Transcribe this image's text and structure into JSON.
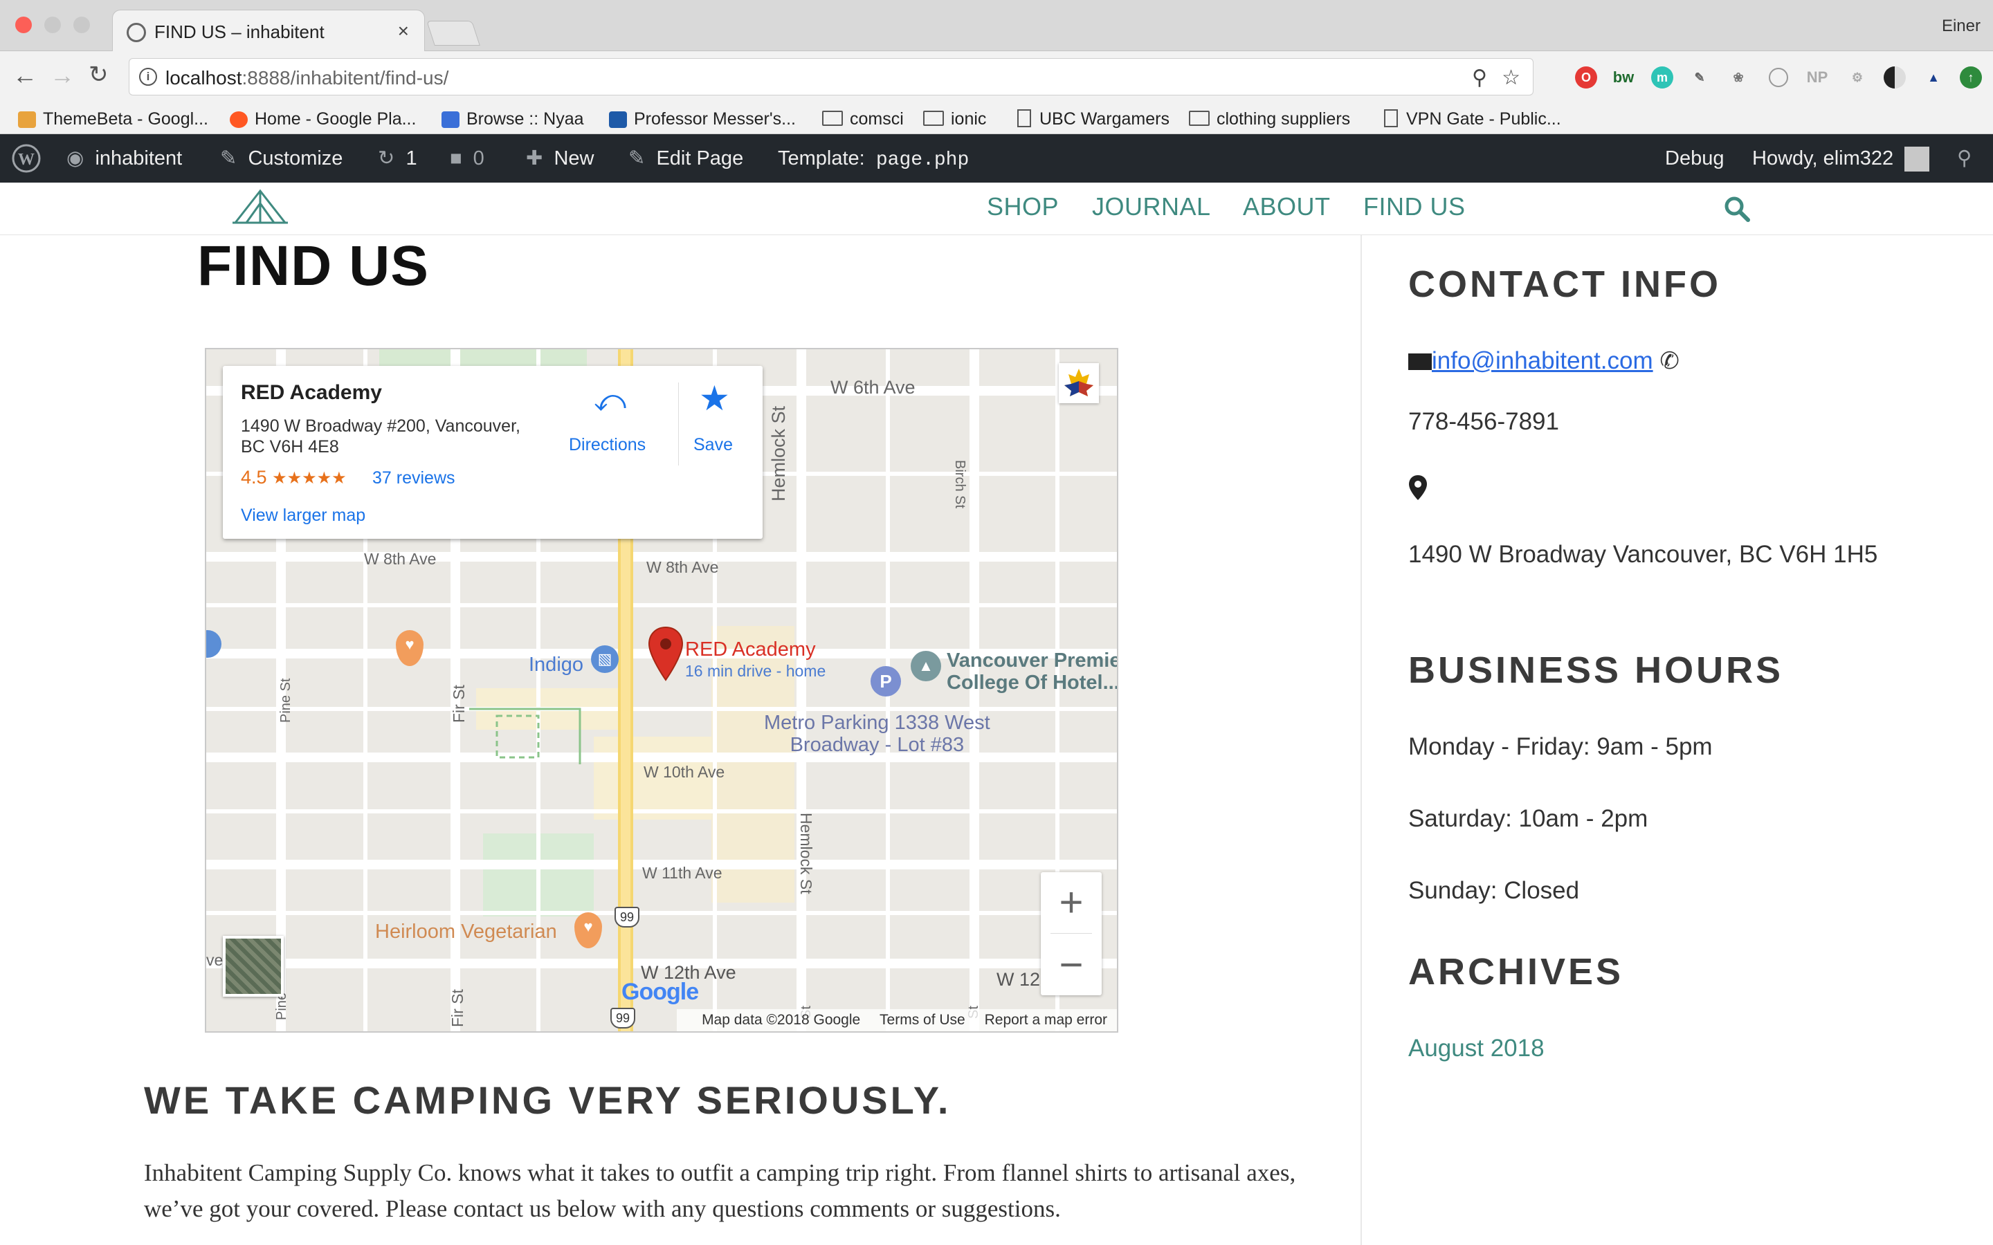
{
  "browser": {
    "tab_title": "FIND US – inhabitent",
    "tab_close": "×",
    "profile_name": "Einer",
    "url_host": "localhost",
    "url_rest": ":8888/inhabitent/find-us/",
    "info_glyph": "i",
    "extensions": [
      "O",
      "bw",
      "m",
      "NP"
    ]
  },
  "bookmarks": [
    {
      "label": "ThemeBeta - Googl...",
      "icon": "themebeta-icon",
      "color": "#e8a33d"
    },
    {
      "label": "Home - Google Pla...",
      "icon": "music-icon",
      "color": "#ff5722"
    },
    {
      "label": "Browse :: Nyaa",
      "icon": "nyaa-icon",
      "color": "#3a6fd8"
    },
    {
      "label": "Professor Messer's...",
      "icon": "professor-icon",
      "color": "#1e5aa8"
    },
    {
      "label": "comsci",
      "icon": "folder-icon"
    },
    {
      "label": "ionic",
      "icon": "folder-icon"
    },
    {
      "label": "UBC Wargamers",
      "icon": "document-icon"
    },
    {
      "label": "clothing suppliers",
      "icon": "folder-icon"
    },
    {
      "label": "VPN Gate - Public...",
      "icon": "document-icon"
    }
  ],
  "adminbar": {
    "site_name": "inhabitent",
    "customize": "Customize",
    "updates_count": "1",
    "comments_count": "0",
    "new_label": "New",
    "edit_label": "Edit Page",
    "template_label": "Template:",
    "template_file": "page.php",
    "debug": "Debug",
    "howdy": "Howdy, elim322"
  },
  "nav": {
    "items": [
      "SHOP",
      "JOURNAL",
      "ABOUT",
      "FIND US"
    ]
  },
  "page": {
    "title": "FIND US",
    "tagline": "WE TAKE CAMPING VERY SERIOUSLY.",
    "body": "Inhabitent Camping Supply Co. knows what it takes to outfit a camping trip right. From flannel shirts to artisanal axes, we’ve got your covered. Please contact us below with any questions comments or suggestions."
  },
  "map": {
    "card": {
      "name": "RED Academy",
      "address": "1490 W Broadway #200, Vancouver, BC V6H 4E8",
      "rating": "4.5",
      "stars": "★★★★★",
      "reviews": "37 reviews",
      "larger": "View larger map",
      "directions": "Directions",
      "save": "Save"
    },
    "streets": [
      "W 6th Ave",
      "W 8th Ave",
      "W 8th Ave",
      "W 10th Ave",
      "W 11th Ave",
      "W 12th Ave",
      "W 12",
      "Hemlock St",
      "Hemlock St",
      "Birch St",
      "Pine St",
      "Fir St",
      "Fir St",
      "Pine",
      "St",
      "St",
      "ve"
    ],
    "pois": {
      "red_academy": "RED Academy",
      "red_sub": "16 min drive - home",
      "indigo": "Indigo",
      "vancouver_premier_1": "Vancouver Premie",
      "vancouver_premier_2": "College Of Hotel...",
      "metro_1": "Metro Parking 1338 West",
      "metro_2": "Broadway - Lot #83",
      "heirloom": "Heirloom Vegetarian",
      "route": "99"
    },
    "zoom_in": "+",
    "zoom_out": "−",
    "google": "Google",
    "footer": {
      "data": "Map data ©2018 Google",
      "terms": "Terms of Use",
      "report": "Report a map error"
    }
  },
  "sidebar": {
    "contact_title": "CONTACT INFO",
    "email": "info@inhabitent.com",
    "phone": "778-456-7891",
    "address": "1490 W Broadway Vancouver, BC V6H 1H5",
    "hours_title": "BUSINESS HOURS",
    "hours": [
      "Monday - Friday: 9am - 5pm",
      "Saturday: 10am - 2pm",
      "Sunday: Closed"
    ],
    "archives_title": "ARCHIVES",
    "archives": [
      "August 2018"
    ]
  },
  "colors": {
    "accent": "#3f8a80",
    "adminbar": "#23282d",
    "link": "#2a6ae3",
    "map_pin": "#d93025"
  }
}
